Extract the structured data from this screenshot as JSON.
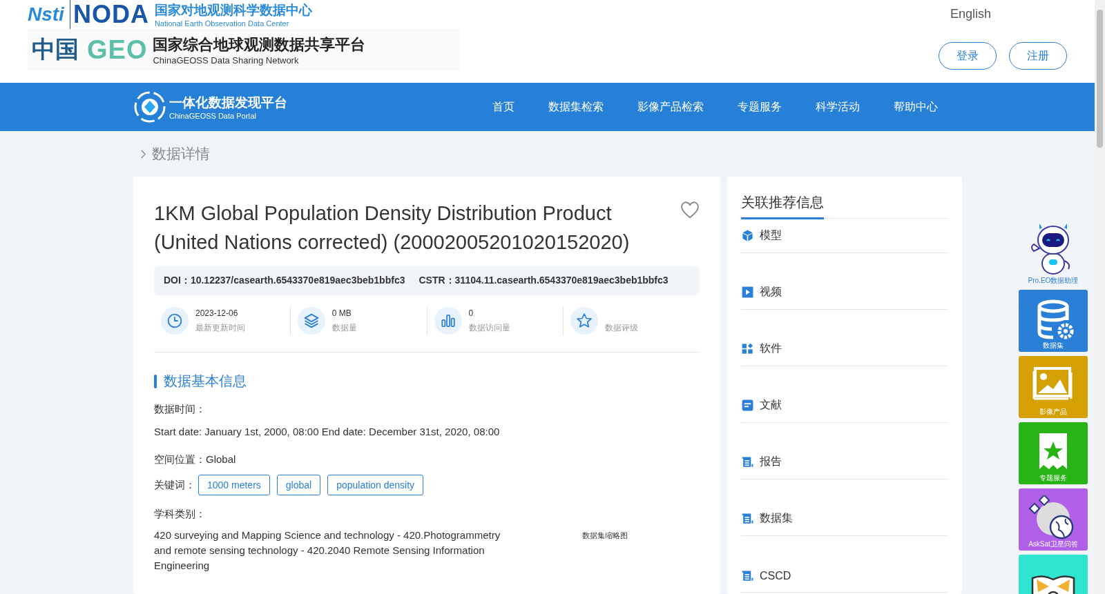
{
  "header": {
    "logo_top": {
      "mark_a": "Nsti",
      "mark_b": "NODA",
      "title": "国家对地观测科学数据中心",
      "subtitle": "National Earth Observation Data Center"
    },
    "logo_bottom": {
      "mark_a": "中国",
      "mark_b": "GEO",
      "title": "国家综合地球观测数据共享平台",
      "subtitle": "ChinaGEOSS Data Sharing Network"
    },
    "language": "English",
    "buttons": [
      "登录",
      "注册"
    ]
  },
  "nav": {
    "portal_title": "一体化数据发现平台",
    "portal_subtitle": "ChinaGEOSS Data Portal",
    "items": [
      {
        "label": "首页",
        "selected": false
      },
      {
        "label": "数据集检索",
        "selected": false
      },
      {
        "label": "影像产品检索",
        "selected": false
      },
      {
        "label": "专题服务",
        "selected": false
      },
      {
        "label": "科学活动",
        "selected": false
      },
      {
        "label": "帮助中心",
        "selected": false
      }
    ]
  },
  "breadcrumb": "数据详情",
  "dataset": {
    "title": "1KM Global Population Density Distribution Product (United Nations corrected) (20002005201020152020)",
    "favorite": false,
    "ids": [
      {
        "label": "DOI：",
        "value": "10.12237/casearth.6543370e819aec3beb1bbfc3"
      },
      {
        "label": "CSTR：",
        "value": "31104.11.casearth.6543370e819aec3beb1bbfc3"
      }
    ],
    "stats": [
      {
        "kind": "clock",
        "value": "2023-12-06",
        "label": "最新更新时间"
      },
      {
        "kind": "layers",
        "value": "0 MB",
        "label": "数据量"
      },
      {
        "kind": "bars",
        "value": "0",
        "label": "数据访问量"
      },
      {
        "kind": "star",
        "label": "数据评级"
      }
    ],
    "section_title": "数据基本信息",
    "time_label": "数据时间：",
    "time_value": "Start date: January 1st, 2000, 08:00 End date: December 31st, 2020, 08:00",
    "location_label": "空间位置：",
    "location_value": "Global",
    "keywords_label": "关键词：",
    "keywords": [
      "1000 meters",
      "global",
      "population density"
    ],
    "subject_label": "学科类别：",
    "subject_value": "420 surveying and Mapping Science and technology - 420.Photogrammetry and remote sensing technology - 420.2040 Remote Sensing Information Engineering",
    "thumbnail_caption": "数据集缩略图"
  },
  "related": {
    "title": "关联推荐信息",
    "items": [
      {
        "kind": "cube",
        "label": "模型"
      },
      {
        "kind": "play",
        "label": "视频"
      },
      {
        "kind": "apps",
        "label": "软件"
      },
      {
        "kind": "doc",
        "label": "文献"
      },
      {
        "kind": "report",
        "label": "报告"
      },
      {
        "kind": "report",
        "label": "数据集"
      },
      {
        "kind": "report",
        "label": "CSCD"
      }
    ]
  },
  "side_tools": {
    "assistant": "Pro.EO数据助理",
    "tiles": [
      {
        "kind": "database",
        "label": "数据集",
        "color": "#2a7fd6"
      },
      {
        "kind": "image",
        "label": "影像产品",
        "color": "#d4a004"
      },
      {
        "kind": "bookmark",
        "label": "专题服务",
        "color": "#28b414"
      },
      {
        "kind": "satellite",
        "label": "AskSat卫星问答",
        "color": "#b060e8"
      },
      {
        "kind": "book",
        "color": "#2ee6d0"
      }
    ]
  }
}
